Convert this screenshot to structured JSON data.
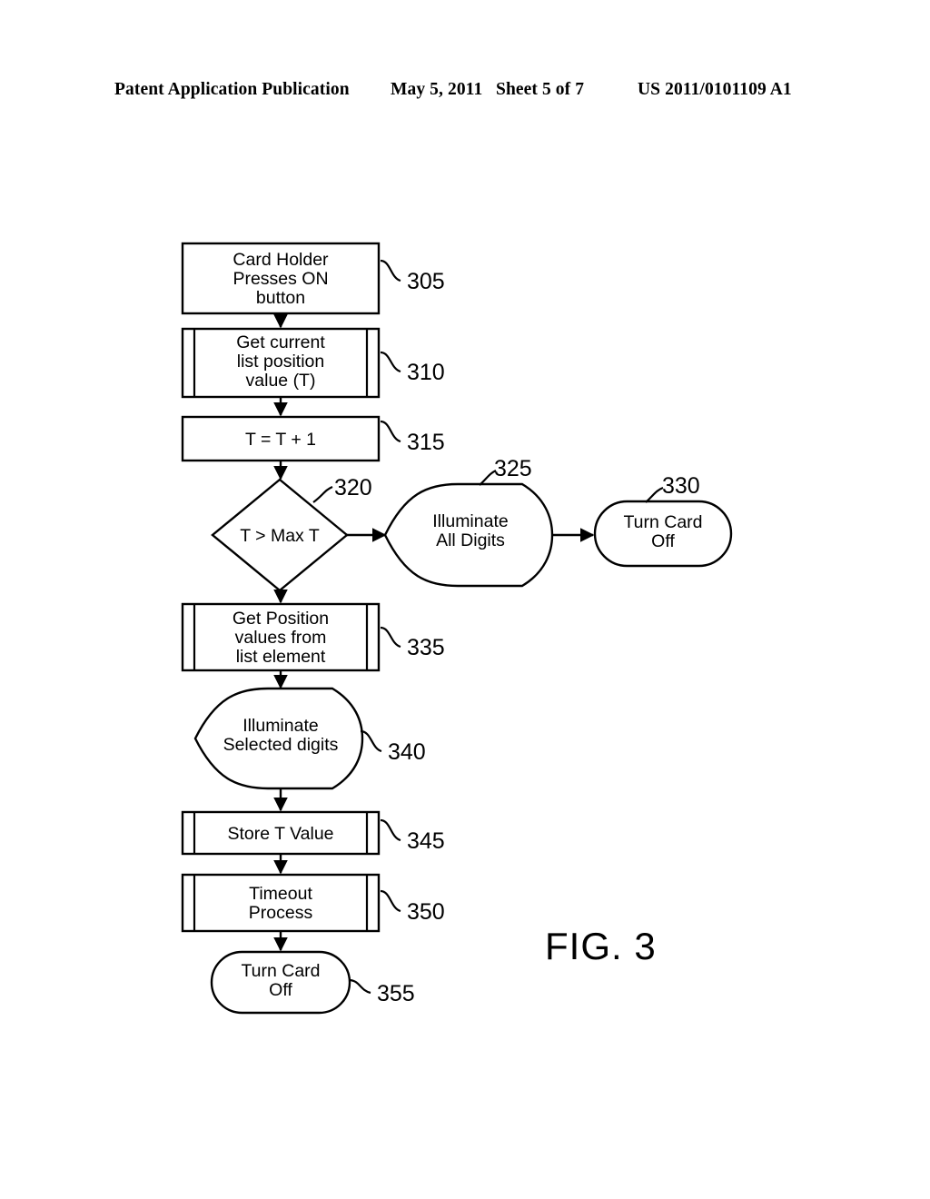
{
  "header": {
    "publication": "Patent Application Publication",
    "date": "May 5, 2011",
    "sheet": "Sheet 5 of 7",
    "patent_number": "US 2011/0101109 A1"
  },
  "figure": {
    "label": "FIG. 3",
    "nodes": [
      {
        "ref": "305",
        "shape": "process",
        "lines": [
          "Card Holder",
          "Presses ON",
          "button"
        ]
      },
      {
        "ref": "310",
        "shape": "predefined-process",
        "lines": [
          "Get current",
          "list position",
          "value (T)"
        ]
      },
      {
        "ref": "315",
        "shape": "process",
        "lines": [
          "T = T + 1"
        ]
      },
      {
        "ref": "320",
        "shape": "decision",
        "lines": [
          "T > Max T"
        ]
      },
      {
        "ref": "325",
        "shape": "display",
        "lines": [
          "Illuminate",
          "All Digits"
        ]
      },
      {
        "ref": "330",
        "shape": "terminator",
        "lines": [
          "Turn Card",
          "Off"
        ]
      },
      {
        "ref": "335",
        "shape": "predefined-process",
        "lines": [
          "Get Position",
          "values from",
          "list element"
        ]
      },
      {
        "ref": "340",
        "shape": "display",
        "lines": [
          "Illuminate",
          "Selected digits"
        ]
      },
      {
        "ref": "345",
        "shape": "predefined-process",
        "lines": [
          "Store T Value"
        ]
      },
      {
        "ref": "350",
        "shape": "predefined-process",
        "lines": [
          "Timeout",
          "Process"
        ]
      },
      {
        "ref": "355",
        "shape": "terminator",
        "lines": [
          "Turn Card",
          "Off"
        ]
      }
    ]
  },
  "chart_data": {
    "type": "diagram",
    "title": "FIG. 3",
    "diagram_kind": "flowchart",
    "nodes": [
      {
        "id": "305",
        "label": "Card Holder Presses ON button",
        "shape": "process"
      },
      {
        "id": "310",
        "label": "Get current list position value (T)",
        "shape": "predefined-process"
      },
      {
        "id": "315",
        "label": "T = T + 1",
        "shape": "process"
      },
      {
        "id": "320",
        "label": "T > Max T",
        "shape": "decision"
      },
      {
        "id": "325",
        "label": "Illuminate All Digits",
        "shape": "display"
      },
      {
        "id": "330",
        "label": "Turn Card Off",
        "shape": "terminator"
      },
      {
        "id": "335",
        "label": "Get Position values from list element",
        "shape": "predefined-process"
      },
      {
        "id": "340",
        "label": "Illuminate Selected digits",
        "shape": "display"
      },
      {
        "id": "345",
        "label": "Store T Value",
        "shape": "predefined-process"
      },
      {
        "id": "350",
        "label": "Timeout Process",
        "shape": "predefined-process"
      },
      {
        "id": "355",
        "label": "Turn Card Off",
        "shape": "terminator"
      }
    ],
    "edges": [
      {
        "from": "305",
        "to": "310",
        "direction": "down"
      },
      {
        "from": "310",
        "to": "315",
        "direction": "down"
      },
      {
        "from": "315",
        "to": "320",
        "direction": "down"
      },
      {
        "from": "320",
        "to": "325",
        "direction": "right"
      },
      {
        "from": "320",
        "to": "335",
        "direction": "down"
      },
      {
        "from": "325",
        "to": "330",
        "direction": "right"
      },
      {
        "from": "335",
        "to": "340",
        "direction": "down"
      },
      {
        "from": "340",
        "to": "345",
        "direction": "down"
      },
      {
        "from": "345",
        "to": "350",
        "direction": "down"
      },
      {
        "from": "350",
        "to": "355",
        "direction": "down"
      }
    ]
  }
}
